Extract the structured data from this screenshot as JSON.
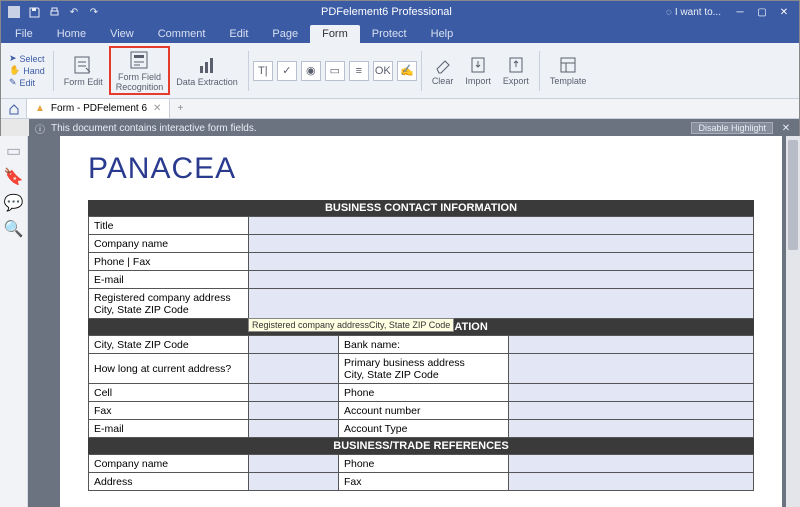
{
  "app": {
    "title": "PDFelement6 Professional",
    "iwant": "I want to..."
  },
  "menu": {
    "file": "File",
    "home": "Home",
    "view": "View",
    "comment": "Comment",
    "edit": "Edit",
    "page": "Page",
    "form": "Form",
    "protect": "Protect",
    "help": "Help"
  },
  "tools": {
    "select": "Select",
    "hand": "Hand",
    "edit": "Edit"
  },
  "ribbon": {
    "form_edit": "Form Edit",
    "form_field_recognition_l1": "Form Field",
    "form_field_recognition_l2": "Recognition",
    "data_extraction": "Data Extraction",
    "clear": "Clear",
    "import": "Import",
    "export": "Export",
    "template": "Template"
  },
  "doc": {
    "tab_label": "Form - PDFelement 6",
    "add": "+"
  },
  "infobar": {
    "msg": "This document contains interactive form fields.",
    "disable": "Disable Highlight"
  },
  "form": {
    "logo": "PANACEA",
    "sec1": "BUSINESS CONTACT INFORMATION",
    "title": "Title",
    "company": "Company name",
    "phonefax": "Phone | Fax",
    "email": "E-mail",
    "reg_addr_l1": "Registered company address",
    "reg_addr_l2": "City, State ZIP Code",
    "tooltip": "Registered company addressCity, State ZIP Code",
    "sec2_suffix": "INFORMATION",
    "city_zip": "City, State ZIP Code",
    "bank": "Bank name:",
    "howlong": "How long at current address?",
    "primary_l1": "Primary business address",
    "primary_l2": "City, State ZIP Code",
    "cell": "Cell",
    "phone": "Phone",
    "fax": "Fax",
    "account_no": "Account number",
    "email2": "E-mail",
    "account_type": "Account Type",
    "sec3": "BUSINESS/TRADE REFERENCES",
    "ref_company": "Company name",
    "ref_phone": "Phone",
    "ref_address": "Address",
    "ref_fax": "Fax"
  }
}
